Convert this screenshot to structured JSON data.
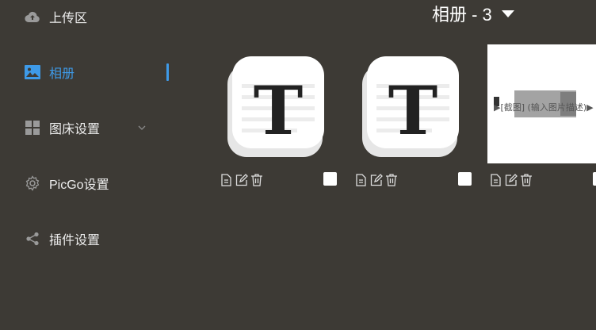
{
  "sidebar": {
    "items": [
      {
        "label": "上传区",
        "icon": "cloud-upload-icon"
      },
      {
        "label": "相册",
        "icon": "image-icon"
      },
      {
        "label": "图床设置",
        "icon": "grid-icon"
      },
      {
        "label": "PicGo设置",
        "icon": "gear-icon"
      },
      {
        "label": "插件设置",
        "icon": "share-icon"
      }
    ]
  },
  "header": {
    "album_title": "相册 - 3"
  },
  "gallery": {
    "items": [
      {
        "type": "typora-icon",
        "glyph": "T"
      },
      {
        "type": "typora-icon",
        "glyph": "T"
      },
      {
        "type": "photo",
        "caption": "▶[截图] (输入图片描述)▶"
      }
    ],
    "actions": [
      "copy-link-icon",
      "edit-icon",
      "delete-icon"
    ]
  },
  "colors": {
    "background": "#3d3a35",
    "accent": "#3e9ae8",
    "text": "#ededed"
  }
}
